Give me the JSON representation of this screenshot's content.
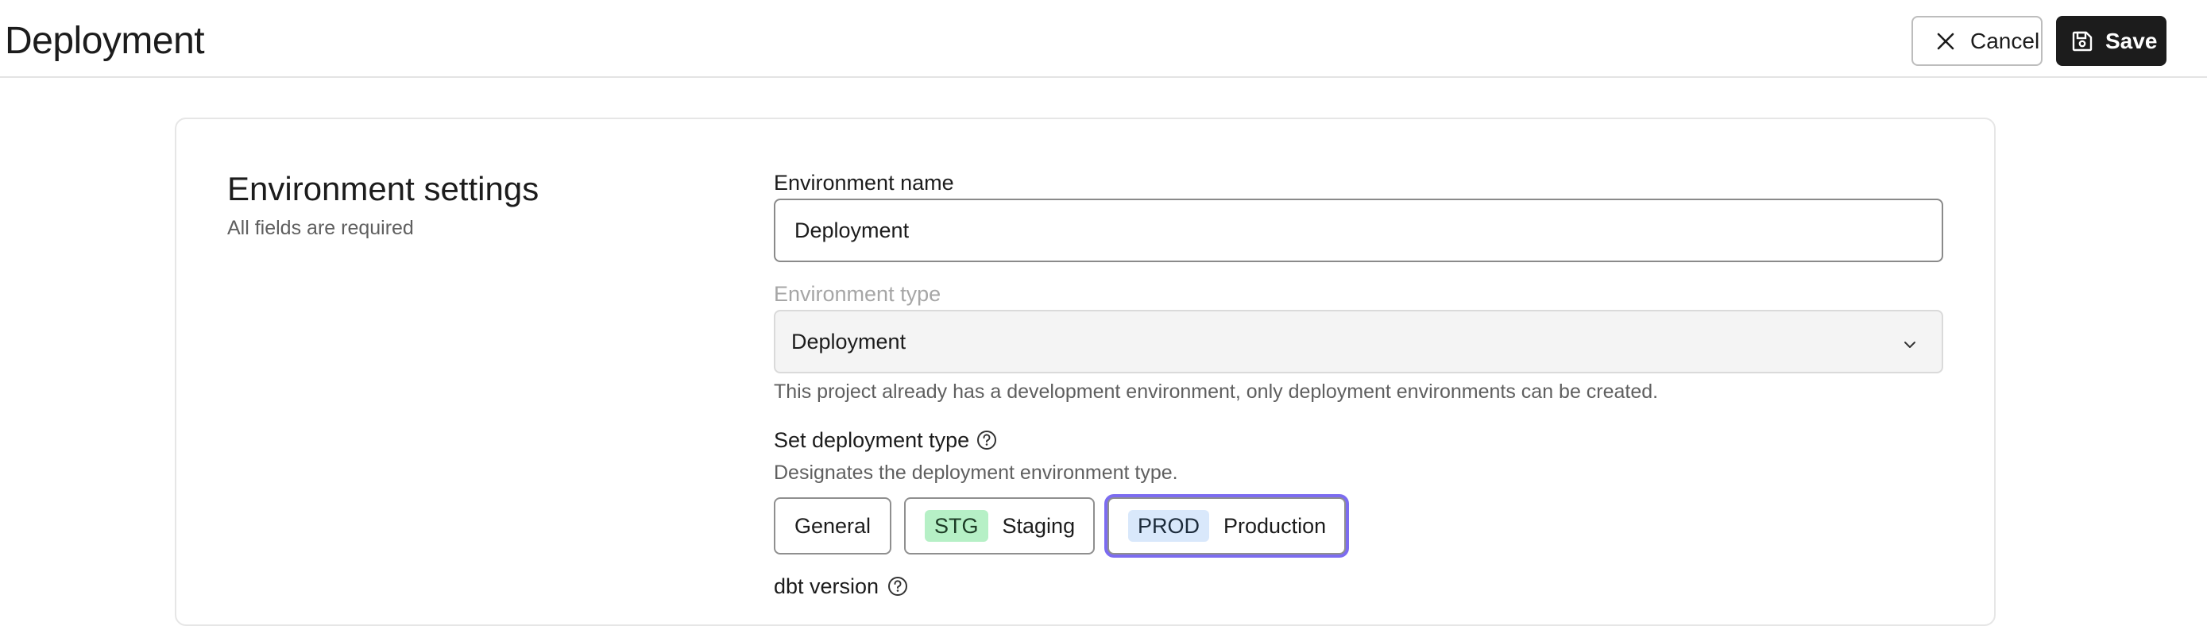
{
  "header": {
    "title": "Deployment",
    "cancel_label": "Cancel",
    "save_label": "Save",
    "cancel_icon": "close-icon",
    "save_icon": "save-icon"
  },
  "settings": {
    "title": "Environment settings",
    "subtitle": "All fields are required"
  },
  "form": {
    "env_name": {
      "label": "Environment name",
      "value": "Deployment"
    },
    "env_type": {
      "label": "Environment type",
      "value": "Deployment",
      "helper": "This project already has a development environment, only deployment environments can be created.",
      "icon": "chevron-down-icon"
    },
    "deployment_type": {
      "label": "Set deployment type",
      "helper": "Designates the deployment environment type.",
      "options": [
        {
          "badge": "",
          "label": "General"
        },
        {
          "badge": "STG",
          "label": "Staging"
        },
        {
          "badge": "PROD",
          "label": "Production"
        }
      ],
      "selected": "Production",
      "help_icon": "help-circle-icon"
    },
    "dbt_version": {
      "label": "dbt version",
      "help_icon": "help-circle-icon"
    }
  },
  "colors": {
    "primary_button": "#1c1c1c",
    "selected_outline": "#7c6cf0",
    "stg_badge": "#b6f0c6",
    "prod_badge": "#d9e8fb"
  }
}
